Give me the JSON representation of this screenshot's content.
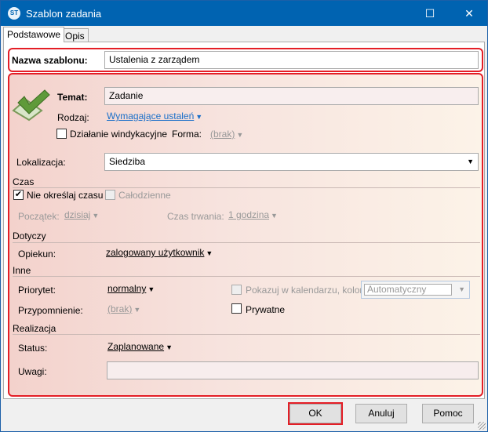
{
  "window": {
    "title": "Szablon zadania",
    "minimize": "—",
    "maximize": "☐",
    "close": "✕",
    "logo": "ST"
  },
  "tabs": [
    {
      "label": "Podstawowe",
      "active": true
    },
    {
      "label": "Opis",
      "active": false
    }
  ],
  "name": {
    "label": "Nazwa szablonu:",
    "value": "Ustalenia z zarządem"
  },
  "task": {
    "subject_label": "Temat:",
    "subject_value": "Zadanie",
    "type_label": "Rodzaj:",
    "type_value": "Wymagające ustaleń",
    "debt_label": "Działanie windykacyjne",
    "debt_checked": false,
    "form_label": "Forma:",
    "form_value": "(brak)"
  },
  "location": {
    "label": "Lokalizacja:",
    "value": "Siedziba"
  },
  "time": {
    "section": "Czas",
    "no_time_label": "Nie określaj czasu",
    "no_time_checked": true,
    "all_day_label": "Całodzienne",
    "all_day_checked": false,
    "start_label": "Początek:",
    "start_value": "dzisiaj",
    "duration_label": "Czas trwania:",
    "duration_value": "1 godzina"
  },
  "concerns": {
    "section": "Dotyczy",
    "guardian_label": "Opiekun:",
    "guardian_value": "zalogowany użytkownik"
  },
  "other": {
    "section": "Inne",
    "priority_label": "Priorytet:",
    "priority_value": "normalny",
    "reminder_label": "Przypomnienie:",
    "reminder_value": "(brak)",
    "calendar_label": "Pokazuj w kalendarzu, kolor:",
    "calendar_checked": false,
    "color_value": "Automatyczny",
    "private_label": "Prywatne",
    "private_checked": false
  },
  "realization": {
    "section": "Realizacja",
    "status_label": "Status:",
    "status_value": "Zaplanowane",
    "notes_label": "Uwagi:",
    "notes_value": ""
  },
  "buttons": {
    "ok": "OK",
    "cancel": "Anuluj",
    "help": "Pomoc"
  },
  "colors": {
    "titlebar": "#0063b1",
    "highlight": "#e41e26",
    "link": "#1a6fc9"
  }
}
